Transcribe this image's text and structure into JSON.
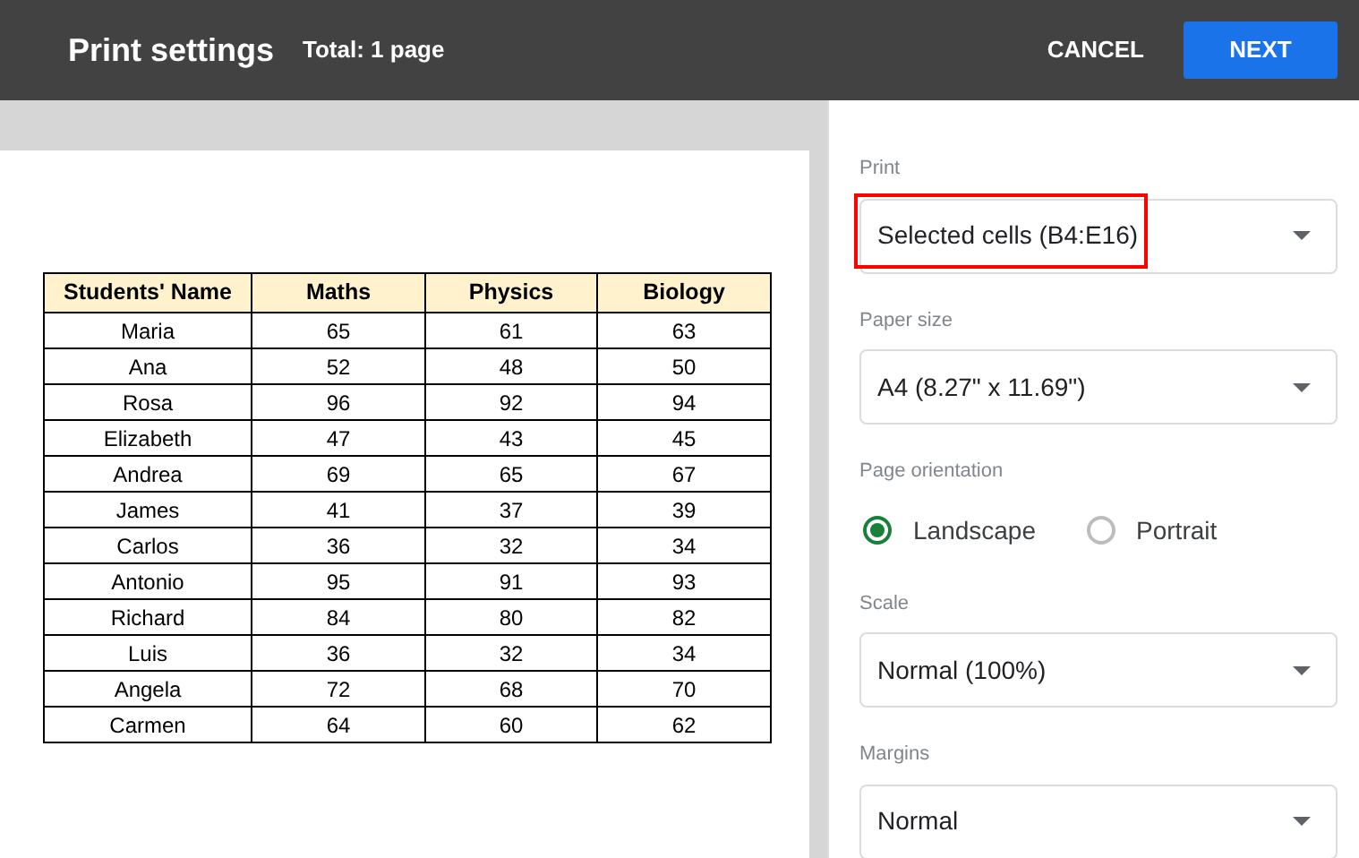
{
  "header": {
    "title": "Print settings",
    "total": "Total: 1 page",
    "buttons": [
      {
        "label": "CANCEL",
        "kind": "text"
      },
      {
        "label": "NEXT",
        "kind": "primary"
      }
    ]
  },
  "table": {
    "columns": [
      "Students' Name",
      "Maths",
      "Physics",
      "Biology"
    ],
    "rows": [
      [
        "Maria",
        "65",
        "61",
        "63"
      ],
      [
        "Ana",
        "52",
        "48",
        "50"
      ],
      [
        "Rosa",
        "96",
        "92",
        "94"
      ],
      [
        "Elizabeth",
        "47",
        "43",
        "45"
      ],
      [
        "Andrea",
        "69",
        "65",
        "67"
      ],
      [
        "James",
        "41",
        "37",
        "39"
      ],
      [
        "Carlos",
        "36",
        "32",
        "34"
      ],
      [
        "Antonio",
        "95",
        "91",
        "93"
      ],
      [
        "Richard",
        "84",
        "80",
        "82"
      ],
      [
        "Luis",
        "36",
        "32",
        "34"
      ],
      [
        "Angela",
        "72",
        "68",
        "70"
      ],
      [
        "Carmen",
        "64",
        "60",
        "62"
      ]
    ]
  },
  "settings": [
    {
      "kind": "dropdown",
      "label": "Print",
      "value": "Selected cells (B4:E16)",
      "highlighted": true
    },
    {
      "kind": "dropdown",
      "label": "Paper size",
      "value": "A4 (8.27\" x 11.69\")",
      "highlighted": false
    },
    {
      "kind": "radio",
      "label": "Page orientation",
      "options": [
        {
          "label": "Landscape",
          "selected": true
        },
        {
          "label": "Portrait",
          "selected": false
        }
      ]
    },
    {
      "kind": "dropdown",
      "label": "Scale",
      "value": "Normal (100%)",
      "highlighted": false
    },
    {
      "kind": "dropdown",
      "label": "Margins",
      "value": "Normal",
      "highlighted": false
    }
  ]
}
